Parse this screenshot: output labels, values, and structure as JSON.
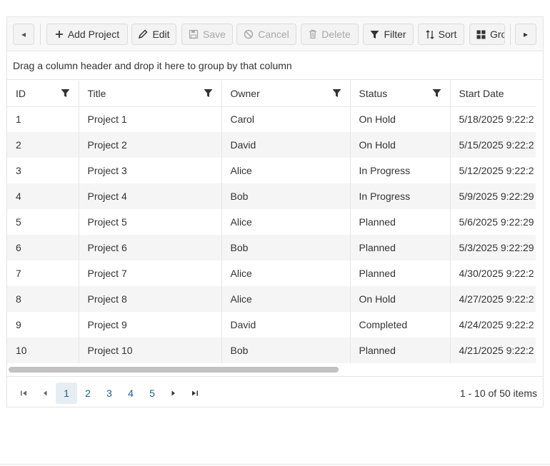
{
  "toolbar": {
    "scroll_left": "◂",
    "scroll_right": "▸",
    "buttons": [
      {
        "label": "Add Project",
        "icon": "plus-icon",
        "enabled": true
      },
      {
        "label": "Edit",
        "icon": "pencil-icon",
        "enabled": true
      },
      {
        "label": "Save",
        "icon": "floppy-disk-icon",
        "enabled": false
      },
      {
        "label": "Cancel",
        "icon": "cancel-circle-icon",
        "enabled": false
      },
      {
        "label": "Delete",
        "icon": "trash-icon",
        "enabled": false
      },
      {
        "label": "Filter",
        "icon": "filter-icon",
        "enabled": true
      },
      {
        "label": "Sort",
        "icon": "sort-icon",
        "enabled": true
      },
      {
        "label": "Gro",
        "icon": "group-icon",
        "enabled": true
      }
    ]
  },
  "group_panel": {
    "text": "Drag a column header and drop it here to group by that column"
  },
  "columns": [
    "ID",
    "Title",
    "Owner",
    "Status",
    "Start Date"
  ],
  "rows": [
    {
      "id": "1",
      "title": "Project 1",
      "owner": "Carol",
      "status": "On Hold",
      "start": "5/18/2025 9:22:2"
    },
    {
      "id": "2",
      "title": "Project 2",
      "owner": "David",
      "status": "On Hold",
      "start": "5/15/2025 9:22:2"
    },
    {
      "id": "3",
      "title": "Project 3",
      "owner": "Alice",
      "status": "In Progress",
      "start": "5/12/2025 9:22:2"
    },
    {
      "id": "4",
      "title": "Project 4",
      "owner": "Bob",
      "status": "In Progress",
      "start": "5/9/2025 9:22:29"
    },
    {
      "id": "5",
      "title": "Project 5",
      "owner": "Alice",
      "status": "Planned",
      "start": "5/6/2025 9:22:29"
    },
    {
      "id": "6",
      "title": "Project 6",
      "owner": "Bob",
      "status": "Planned",
      "start": "5/3/2025 9:22:29"
    },
    {
      "id": "7",
      "title": "Project 7",
      "owner": "Alice",
      "status": "Planned",
      "start": "4/30/2025 9:22:2"
    },
    {
      "id": "8",
      "title": "Project 8",
      "owner": "Alice",
      "status": "On Hold",
      "start": "4/27/2025 9:22:2"
    },
    {
      "id": "9",
      "title": "Project 9",
      "owner": "David",
      "status": "Completed",
      "start": "4/24/2025 9:22:2"
    },
    {
      "id": "10",
      "title": "Project 10",
      "owner": "Bob",
      "status": "Planned",
      "start": "4/21/2025 9:22:2"
    }
  ],
  "pager": {
    "pages": [
      "1",
      "2",
      "3",
      "4",
      "5"
    ],
    "current": "1",
    "info": "1 - 10 of 50 items"
  },
  "colors": {
    "link": "#1a5e9a",
    "active_page_bg": "#e6eef3"
  }
}
